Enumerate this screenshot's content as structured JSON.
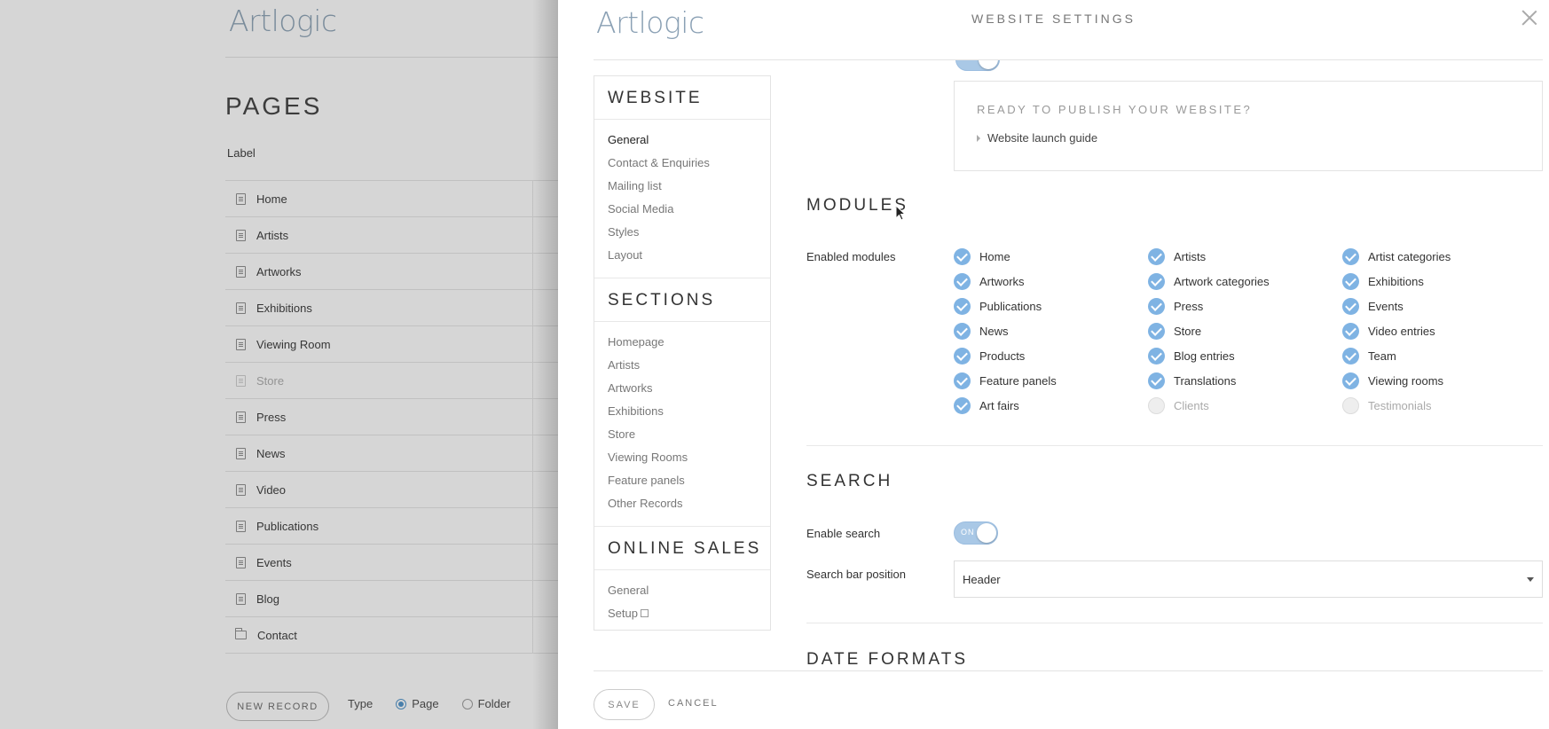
{
  "background": {
    "logo": "Artlogic",
    "title": "PAGES",
    "column_label": "Label",
    "rows": [
      {
        "label": "Home",
        "type": "page",
        "disabled": false
      },
      {
        "label": "Artists",
        "type": "page",
        "disabled": false
      },
      {
        "label": "Artworks",
        "type": "page",
        "disabled": false
      },
      {
        "label": "Exhibitions",
        "type": "page",
        "disabled": false
      },
      {
        "label": "Viewing Room",
        "type": "page",
        "disabled": false
      },
      {
        "label": "Store",
        "type": "page",
        "disabled": true
      },
      {
        "label": "Press",
        "type": "page",
        "disabled": false
      },
      {
        "label": "News",
        "type": "page",
        "disabled": false
      },
      {
        "label": "Video",
        "type": "page",
        "disabled": false
      },
      {
        "label": "Publications",
        "type": "page",
        "disabled": false
      },
      {
        "label": "Events",
        "type": "page",
        "disabled": false
      },
      {
        "label": "Blog",
        "type": "page",
        "disabled": false
      },
      {
        "label": "Contact",
        "type": "folder",
        "disabled": false
      }
    ],
    "new_record": "NEW RECORD",
    "type_label": "Type",
    "type_page": "Page",
    "type_folder": "Folder"
  },
  "modal": {
    "logo": "Artlogic",
    "title": "WEBSITE SETTINGS",
    "nav": {
      "website_head": "WEBSITE",
      "website_items": [
        "General",
        "Contact & Enquiries",
        "Mailing list",
        "Social Media",
        "Styles",
        "Layout"
      ],
      "sections_head": "SECTIONS",
      "sections_items": [
        "Homepage",
        "Artists",
        "Artworks",
        "Exhibitions",
        "Store",
        "Viewing Rooms",
        "Feature panels",
        "Other Records"
      ],
      "online_sales_head": "ONLINE SALES",
      "online_sales_items": [
        "General",
        "Setup"
      ]
    },
    "publish": {
      "title": "READY TO PUBLISH YOUR WEBSITE?",
      "guide": "Website launch guide"
    },
    "modules": {
      "title": "MODULES",
      "label": "Enabled modules",
      "items": [
        {
          "label": "Home",
          "on": true
        },
        {
          "label": "Artists",
          "on": true
        },
        {
          "label": "Artist categories",
          "on": true
        },
        {
          "label": "Artworks",
          "on": true
        },
        {
          "label": "Artwork categories",
          "on": true
        },
        {
          "label": "Exhibitions",
          "on": true
        },
        {
          "label": "Publications",
          "on": true
        },
        {
          "label": "Press",
          "on": true
        },
        {
          "label": "Events",
          "on": true
        },
        {
          "label": "News",
          "on": true
        },
        {
          "label": "Store",
          "on": true
        },
        {
          "label": "Video entries",
          "on": true
        },
        {
          "label": "Products",
          "on": true
        },
        {
          "label": "Blog entries",
          "on": true
        },
        {
          "label": "Team",
          "on": true
        },
        {
          "label": "Feature panels",
          "on": true
        },
        {
          "label": "Translations",
          "on": true
        },
        {
          "label": "Viewing rooms",
          "on": true
        },
        {
          "label": "Art fairs",
          "on": true
        },
        {
          "label": "Clients",
          "on": false
        },
        {
          "label": "Testimonials",
          "on": false
        }
      ]
    },
    "search": {
      "title": "SEARCH",
      "enable_label": "Enable search",
      "toggle_text": "ON",
      "position_label": "Search bar position",
      "position_value": "Header"
    },
    "date_formats": {
      "title": "DATE FORMATS"
    },
    "save": "SAVE",
    "cancel": "CANCEL"
  },
  "colors": {
    "accent": "#7fb3e3",
    "toggle_on": "#a9c8e6",
    "logo": "#8aa0b4"
  }
}
